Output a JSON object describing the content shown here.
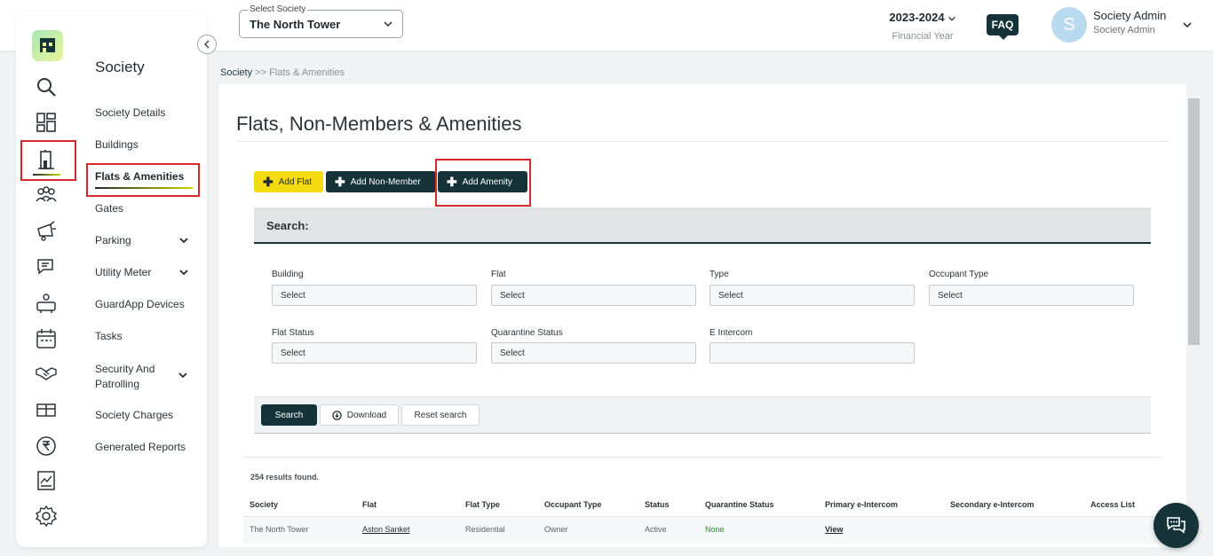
{
  "header": {
    "society_select": {
      "label": "Select Society",
      "value": "The North Tower"
    },
    "financial_year": {
      "value": "2023-2024",
      "label": "Financial Year"
    },
    "faq_label": "FAQ",
    "user": {
      "initial": "S",
      "name": "Society Admin",
      "role": "Society Admin"
    }
  },
  "sidebar": {
    "title": "Society",
    "items": [
      {
        "label": "Society Details"
      },
      {
        "label": "Buildings"
      },
      {
        "label": "Flats & Amenities",
        "active": true
      },
      {
        "label": "Gates"
      },
      {
        "label": "Parking"
      },
      {
        "label": "Utility Meter"
      },
      {
        "label": "GuardApp Devices"
      },
      {
        "label": "Tasks"
      },
      {
        "label": "Security And Patrolling"
      },
      {
        "label": "Society Charges"
      },
      {
        "label": "Generated Reports"
      }
    ]
  },
  "breadcrumb": {
    "root": "Society",
    "separator": ">>",
    "current": "Flats & Amenities"
  },
  "page": {
    "title": "Flats, Non-Members & Amenities",
    "actions": {
      "add_flat": "Add Flat",
      "add_non_member": "Add Non-Member",
      "add_amenity": "Add Amenity"
    },
    "search": {
      "heading": "Search:",
      "fields": [
        {
          "label": "Building",
          "value": "Select"
        },
        {
          "label": "Flat",
          "value": "Select"
        },
        {
          "label": "Type",
          "value": "Select"
        },
        {
          "label": "Occupant Type",
          "value": "Select"
        },
        {
          "label": "Flat Status",
          "value": "Select"
        },
        {
          "label": "Quarantine Status",
          "value": "Select"
        },
        {
          "label": "E Intercom",
          "value": ""
        }
      ],
      "buttons": {
        "search": "Search",
        "download": "Download",
        "reset": "Reset search"
      }
    },
    "results_text": "254 results found.",
    "table": {
      "columns": [
        "Society",
        "Flat",
        "Flat Type",
        "Occupant Type",
        "Status",
        "Quarantine Status",
        "Primary e-Intercom",
        "Secondary e-Intercom",
        "Access List"
      ],
      "rows": [
        {
          "society": "The North Tower",
          "flat": "Aston Sanket",
          "flat_type": "Residential",
          "occupant_type": "Owner",
          "status": "Active",
          "quarantine": "None",
          "primary": "View",
          "secondary": "",
          "access": ""
        }
      ]
    }
  },
  "colors": {
    "primary_dark": "#163339",
    "accent_yellow": "#f5dc12",
    "highlight_red": "#d62828",
    "status_green": "#2f8a2f"
  }
}
